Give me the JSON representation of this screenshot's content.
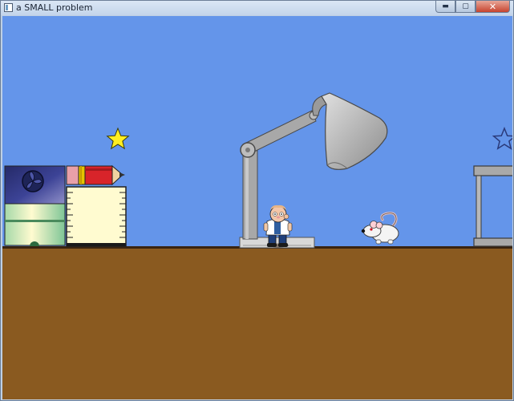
{
  "window": {
    "title": "a SMALL problem",
    "controls": [
      {
        "name": "minimize",
        "glyph": "▬"
      },
      {
        "name": "maximize",
        "glyph": "▢"
      },
      {
        "name": "close",
        "glyph": "✕"
      }
    ]
  },
  "scene": {
    "colors": {
      "sky": "#6495ea",
      "floor": "#8a5a20",
      "floor_edge": "#3a2410",
      "star": "#ffee22",
      "pencil": "#d8242a",
      "lamp": "#b3b3b3",
      "box_top": "#2e3575",
      "box_bottom": "#8ecaa0",
      "ruler": "#fffbd0"
    },
    "sprites": [
      "player",
      "lab-rat",
      "desk-lamp",
      "pencil",
      "ruler",
      "storage-box",
      "collectible-star",
      "star-outline",
      "metal-shelf"
    ]
  }
}
